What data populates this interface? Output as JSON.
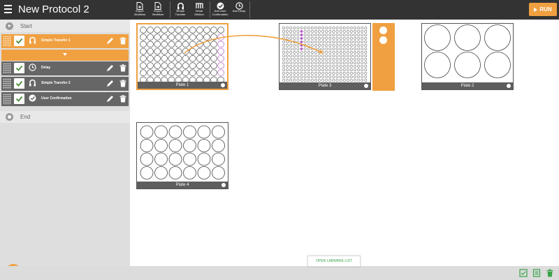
{
  "app": {
    "title": "New Protocol 2"
  },
  "toolbar": [
    {
      "label": "Import Workflow",
      "icon": "import-file-icon"
    },
    {
      "label": "Export Workflow",
      "icon": "export-file-icon"
    },
    {
      "label": "Simple Transfer",
      "icon": "simple-transfer-icon"
    },
    {
      "label": "Serial Dilution",
      "icon": "serial-dilution-icon"
    },
    {
      "label": "Add User Confirmation",
      "icon": "user-confirmation-icon"
    },
    {
      "label": "Add Delay",
      "icon": "clock-icon"
    }
  ],
  "run_label": "RUN",
  "sidebar": {
    "start": "Start",
    "end": "End",
    "steps": [
      {
        "label": "Simple Transfer 1",
        "icon": "simple-transfer-icon",
        "checked": true,
        "active": true
      },
      {
        "label": "Delay",
        "icon": "clock-icon",
        "checked": true,
        "active": false
      },
      {
        "label": "Simple Transfer 2",
        "icon": "simple-transfer-icon",
        "checked": true,
        "active": false
      },
      {
        "label": "User Confirmation",
        "icon": "user-confirmation-icon",
        "checked": true,
        "active": false
      }
    ]
  },
  "plates": [
    {
      "label": "Plate 1",
      "wells": 96,
      "rows": 8,
      "cols": 12,
      "selected": true
    },
    {
      "label": "Plate 3",
      "wells": 384,
      "rows": 16,
      "cols": 24,
      "selected": false
    },
    {
      "label": "Plate 2",
      "wells": 6,
      "rows": 2,
      "cols": 3,
      "selected": false
    },
    {
      "label": "Plate 4",
      "wells": 24,
      "rows": 4,
      "cols": 6,
      "selected": false
    }
  ],
  "labware_button": "OPEN LABWARE LIST",
  "colors": {
    "accent": "#f0a040",
    "dark": "#333333",
    "step": "#666666",
    "highlight_well": "#b05cc8",
    "green": "#3aa34a"
  }
}
